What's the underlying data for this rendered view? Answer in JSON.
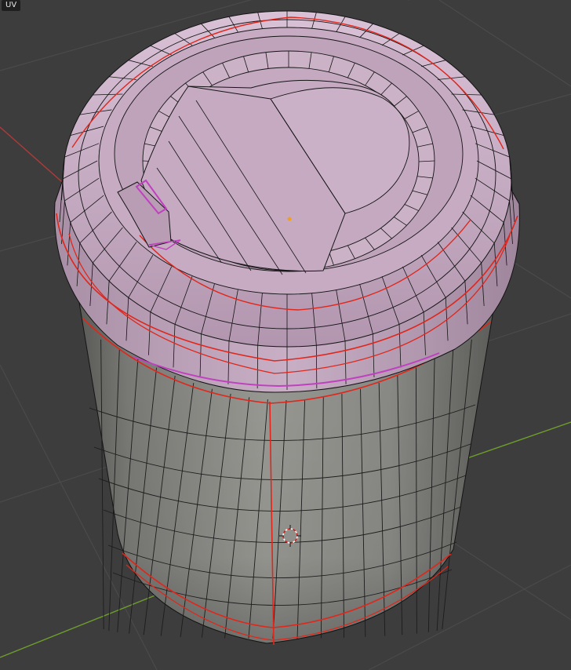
{
  "viewport": {
    "uv_label": "UV"
  },
  "colors": {
    "background": "#3d3d3d",
    "grid": "#484848",
    "axis_x": "#b23a3a",
    "axis_y": "#6e9e2c",
    "body_face": "#8e8e8a",
    "lid_face": "#cbb0c8",
    "wire": "#141414",
    "seam": "#e1261b",
    "selected": "#c040c0",
    "origin": "#f0a020"
  }
}
